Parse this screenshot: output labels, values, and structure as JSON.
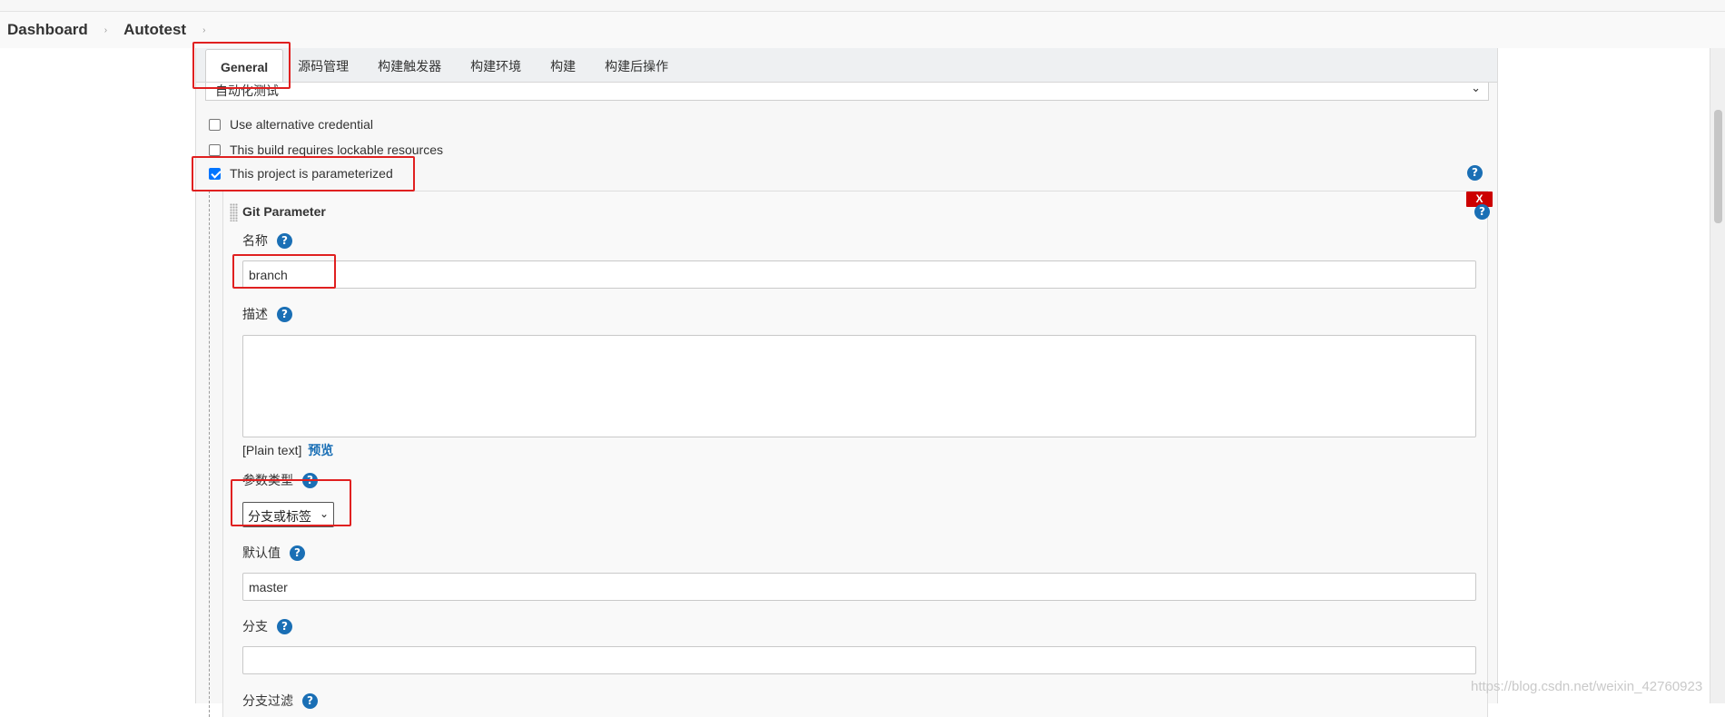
{
  "breadcrumb": {
    "items": [
      "Dashboard",
      "Autotest"
    ],
    "separator": "›"
  },
  "tabs": [
    {
      "label": "General",
      "active": true
    },
    {
      "label": "源码管理",
      "active": false
    },
    {
      "label": "构建触发器",
      "active": false
    },
    {
      "label": "构建环境",
      "active": false
    },
    {
      "label": "构建",
      "active": false
    },
    {
      "label": "构建后操作",
      "active": false
    }
  ],
  "top_select": {
    "value": "自动化测试",
    "chevron": "⌄"
  },
  "options": {
    "alt_credential": {
      "label": "Use alternative credential",
      "checked": false
    },
    "lockable_resources": {
      "label": "This build requires lockable resources",
      "checked": false
    },
    "parameterized": {
      "label": "This project is parameterized",
      "checked": true
    }
  },
  "help_glyph": "?",
  "git_parameter": {
    "title": "Git Parameter",
    "delete_label": "X",
    "name": {
      "label": "名称",
      "value": "branch"
    },
    "description": {
      "label": "描述",
      "value": ""
    },
    "format": {
      "plain": "[Plain text]",
      "preview": "预览"
    },
    "param_type": {
      "label": "参数类型",
      "value": "分支或标签",
      "chevron": "⌄"
    },
    "default_value": {
      "label": "默认值",
      "value": "master"
    },
    "branch": {
      "label": "分支",
      "value": ""
    },
    "branch_filter": {
      "label": "分支过滤"
    }
  },
  "watermark": "https://blog.csdn.net/weixin_42760923",
  "colors": {
    "help_blue": "#1a6fb5",
    "delete_red": "#cc0000",
    "highlight_red": "#e02020",
    "checkbox_blue": "#0075ff"
  },
  "icons": [
    "help-icon",
    "drag-handle-icon",
    "chevron-down-icon",
    "resize-grip-icon"
  ]
}
